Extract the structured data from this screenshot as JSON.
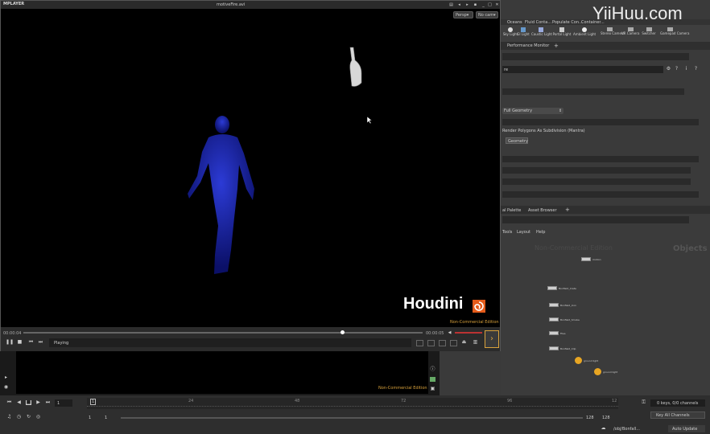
{
  "watermark": "YiiHuu.com",
  "mplay": {
    "logo": "MPLAYER",
    "title": "motiveFire.avi",
    "persp_label": "Persp▾",
    "cam_label": "No cam▾",
    "houdini_brand": "Houdini",
    "edition": "Non-Commercial Edition",
    "time_start": "00:00:04",
    "time_end": "00:00:05",
    "status": "Playing"
  },
  "shelf": {
    "tabs": [
      "Oceans",
      "Fluid Conta...",
      "Populate Con...",
      "Container..."
    ],
    "tools": [
      "Sky Light",
      "GI Light",
      "Caustic Light",
      "Portal Light",
      "Ambient Light",
      "Stereo Camera",
      "VR Camera",
      "Switcher",
      "Gamepad Camera"
    ]
  },
  "panes": {
    "tab1_label": "Performance Monitor",
    "path_suffix": "re",
    "dropdown1": "Full Geometry",
    "check_label": "Render Polygons As Subdivision (Mantra)",
    "geo_button": "Geometry",
    "tab2a": "al Palette",
    "tab2b": "Asset Browser",
    "menu": [
      "Tools",
      "Layout",
      "Help"
    ],
    "network_watermark": "Non-Commercial Edition",
    "network_label": "Objects"
  },
  "nodes": [
    {
      "label": "motion"
    },
    {
      "label": "Bonfield_Crete"
    },
    {
      "label": "Bonfield_Icon"
    },
    {
      "label": "Bonfield_Smoke"
    },
    {
      "label": "Files"
    },
    {
      "label": "Bonfield_Clip"
    },
    {
      "label": "ground light"
    },
    {
      "label": "ground light"
    }
  ],
  "bottom_edition": "Non-Commercial Edition",
  "timeline": {
    "frame_current": "1",
    "ticks": [
      "1",
      "24",
      "48",
      "72",
      "96",
      "12"
    ],
    "range_start": "1",
    "range_start2": "1",
    "range_end": "128",
    "range_end2": "128",
    "keys_info": "0 keys, 0/0 channels",
    "key_all": "Key All Channels",
    "obj_path": "/obj/Bonfall...",
    "auto_update": "Auto Update"
  }
}
